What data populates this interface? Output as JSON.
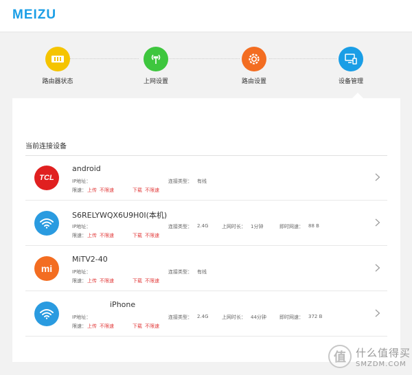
{
  "brand": {
    "logo": "MEIZU",
    "color": "#1a9ee6"
  },
  "steps": [
    {
      "label": "路由器状态",
      "icon": "router-status-icon",
      "color": "#f5c400"
    },
    {
      "label": "上网设置",
      "icon": "antenna-icon",
      "color": "#3ec63e"
    },
    {
      "label": "路由设置",
      "icon": "gear-icon",
      "color": "#f36d21"
    },
    {
      "label": "设备管理",
      "icon": "monitor-icon",
      "color": "#1a9ee6",
      "active": true
    }
  ],
  "section": {
    "title": "当前连接设备"
  },
  "labels": {
    "ip": "IP地址：",
    "speed_limit": "限速：",
    "upload": "上传",
    "download": "下载",
    "unlimited": "不限速",
    "conn_type": "连接类型：",
    "online_time": "上网时长：",
    "realtime_speed": "即时网速："
  },
  "devices": [
    {
      "name": "android",
      "avatar": "TCL",
      "avatar_color": "#e02020",
      "conn_type": "有线",
      "online_time": "",
      "speed": ""
    },
    {
      "name": "S6RELYWQX6U9H0I(本机)",
      "avatar": "wifi-icon",
      "avatar_color": "#2a9be0",
      "conn_type": "2.4G",
      "online_time": "1分钟",
      "speed": "88 B"
    },
    {
      "name": "MiTV2-40",
      "avatar": "mi",
      "avatar_color": "#f36d21",
      "conn_type": "有线",
      "online_time": "",
      "speed": ""
    },
    {
      "name": "iPhone",
      "avatar": "wifi-icon",
      "avatar_color": "#2a9be0",
      "conn_type": "2.4G",
      "online_time": "44分钟",
      "speed": "372 B"
    }
  ],
  "watermark": {
    "line1": "什么值得买",
    "line2": "SMZDM.COM",
    "badge": "值"
  }
}
